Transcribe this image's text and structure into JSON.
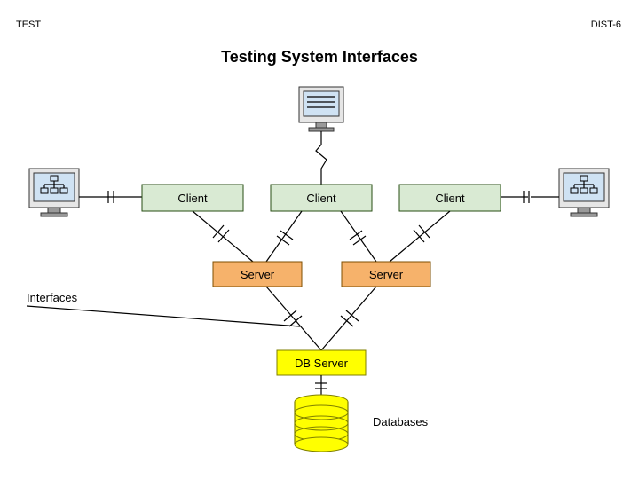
{
  "header": {
    "left": "TEST",
    "right": "DIST-6"
  },
  "title": "Testing System Interfaces",
  "clients": {
    "a": "Client",
    "b": "Client",
    "c": "Client"
  },
  "servers": {
    "a": "Server",
    "b": "Server"
  },
  "dbserver": "DB Server",
  "databases_label": "Databases",
  "interfaces_label": "Interfaces"
}
